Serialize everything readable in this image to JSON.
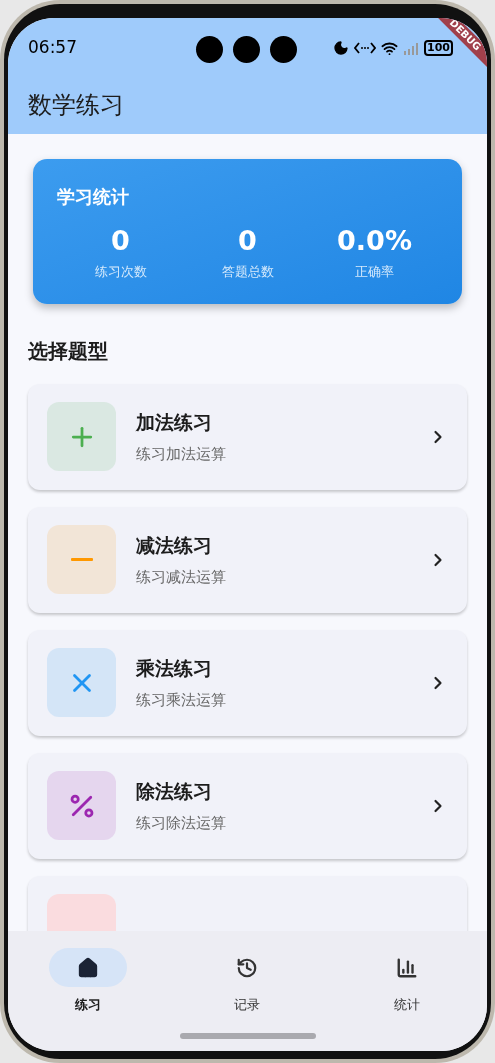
{
  "status_bar": {
    "time": "06:57",
    "battery": "100"
  },
  "debug_banner": "DEBUG",
  "app_bar": {
    "title": "数学练习"
  },
  "stats_card": {
    "title": "学习统计",
    "stats": [
      {
        "value": "0",
        "label": "练习次数"
      },
      {
        "value": "0",
        "label": "答题总数"
      },
      {
        "value": "0.0%",
        "label": "正确率"
      }
    ]
  },
  "section_title": "选择题型",
  "practice_types": [
    {
      "kind": "add",
      "color": "#4caf50",
      "title": "加法练习",
      "subtitle": "练习加法运算"
    },
    {
      "kind": "subtract",
      "color": "#ff9800",
      "title": "减法练习",
      "subtitle": "练习减法运算"
    },
    {
      "kind": "multiply",
      "color": "#2196f3",
      "title": "乘法练习",
      "subtitle": "练习乘法运算"
    },
    {
      "kind": "divide",
      "color": "#9c27b0",
      "title": "除法练习",
      "subtitle": "练习除法运算"
    },
    {
      "kind": "other",
      "color": "#fadcdf"
    }
  ],
  "bottom_nav": [
    {
      "kind": "home",
      "label": "练习",
      "selected": true
    },
    {
      "kind": "history",
      "label": "记录",
      "selected": false
    },
    {
      "kind": "chart",
      "label": "统计",
      "selected": false
    }
  ]
}
